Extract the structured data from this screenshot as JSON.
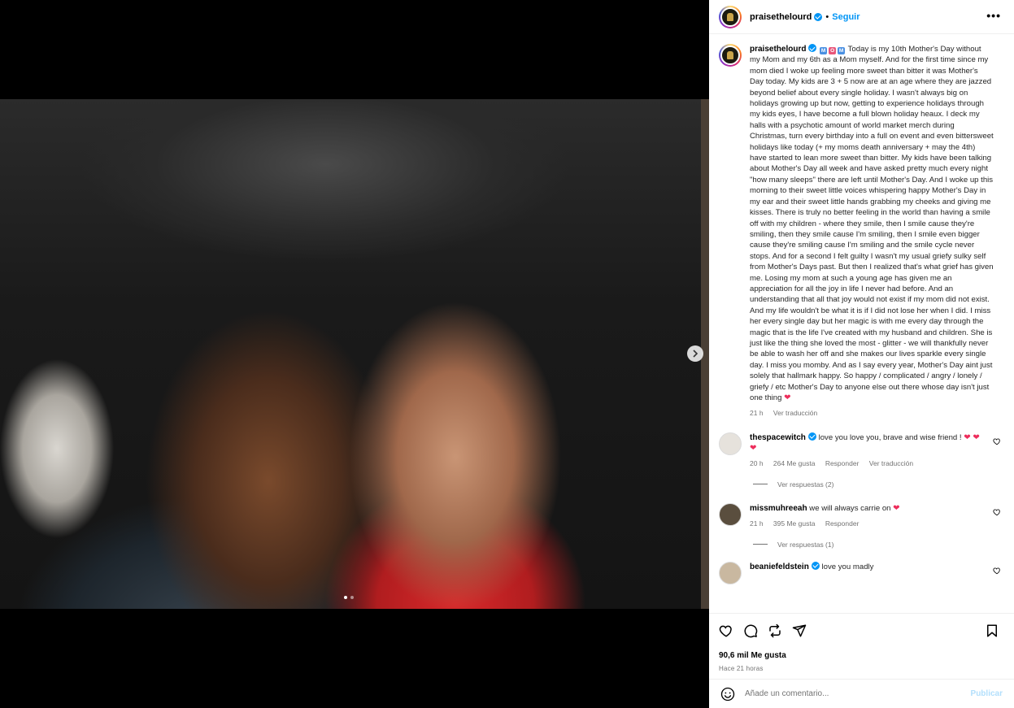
{
  "post": {
    "username": "praisethelourd",
    "follow_label": "Seguir",
    "separator": "•",
    "more_label": "•••"
  },
  "caption": {
    "username": "praisethelourd",
    "emojis": [
      {
        "char": "M",
        "color": "#4a90e2"
      },
      {
        "char": "O",
        "color": "#e8567a"
      },
      {
        "char": "M",
        "color": "#4a90e2"
      }
    ],
    "text": "Today is my 10th Mother's Day without my Mom and my 6th as a Mom myself. And for the first time since my mom died I woke up feeling more sweet than bitter it was Mother's Day today. My kids are 3 + 5 now are at an age where they are jazzed beyond belief about every single holiday. I wasn't always big on holidays growing up but now, getting to experience holidays through my kids eyes, I have become a full blown holiday heaux. I deck my halls with a psychotic amount of world market merch during Christmas, turn every birthday into a full on event and even bittersweet holidays like today (+ my moms death anniversary + may the 4th) have started to lean more sweet than bitter. My kids have been talking about Mother's Day all week and have asked pretty much every night \"how many sleeps\" there are left until Mother's Day. And I woke up this morning to their sweet little voices whispering happy Mother's Day in my ear and their sweet little hands grabbing my cheeks and giving me kisses. There is truly no better feeling in the world than having a smile off with my children - where they smile, then I smile cause they're smiling, then they smile cause I'm smiling, then I smile even bigger cause they're smiling cause I'm smiling and the smile cycle never stops. And for a second I felt guilty I wasn't my usual griefy sulky self from Mother's Days past. But then I realized that's what grief has given me. Losing my mom at such a young age has given me an appreciation for all the joy in life I never had before. And an understanding that all that joy would not exist if my mom did not exist. And my life wouldn't be what it is if I did not lose her when I did. I miss her every single day but her magic is with me every day through the magic that is the life I've created with my husband and children. She is just like the thing she loved the most - glitter - we will thankfully never be able to wash her off and she makes our lives sparkle every single day. I miss you momby. And as I say every year, Mother's Day aint just solely that hallmark happy. So happy / complicated / angry / lonely / griefy / etc Mother's Day to anyone else out there whose day isn't just one thing",
    "end_emoji": "❤",
    "age": "21 h",
    "translate": "Ver traducción"
  },
  "comments": [
    {
      "username": "thespacewitch",
      "verified": true,
      "text": "love you love you, brave and wise friend ! ",
      "hearts": "❤ ❤ ❤",
      "age": "20 h",
      "likes": "264 Me gusta",
      "reply": "Responder",
      "translate": "Ver traducción",
      "replies": "Ver respuestas (2)",
      "avatar_color": "#e6e2dc"
    },
    {
      "username": "missmuhreeah",
      "verified": false,
      "text": "we will always carrie on ",
      "hearts": "❤",
      "age": "21 h",
      "likes": "395 Me gusta",
      "reply": "Responder",
      "translate": "",
      "replies": "Ver respuestas (1)",
      "avatar_color": "#5a4e3e"
    },
    {
      "username": "beaniefeldstein",
      "verified": true,
      "text": "love you madly",
      "hearts": "",
      "avatar_color": "#c9b8a0"
    }
  ],
  "actions": {
    "likes": "90,6 mil Me gusta",
    "time": "Hace 21 horas"
  },
  "composer": {
    "placeholder": "Añade un comentario...",
    "publish": "Publicar"
  },
  "colors": {
    "accent": "#0095f6",
    "heart": "#ed2e5c",
    "muted": "#737373"
  }
}
